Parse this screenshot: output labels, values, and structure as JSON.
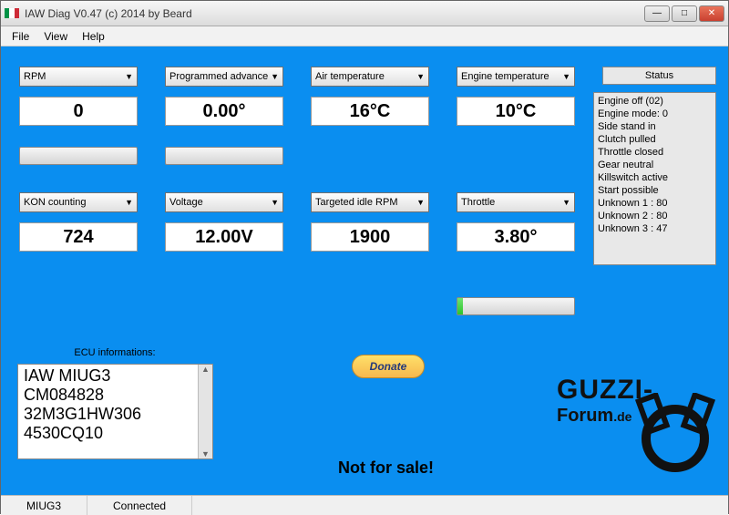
{
  "titlebar": {
    "text": "IAW Diag V0.47  (c) 2014 by Beard"
  },
  "menu": {
    "file": "File",
    "view": "View",
    "help": "Help"
  },
  "dd": {
    "rpm": "RPM",
    "adv": "Programmed advance",
    "air": "Air temperature",
    "eng": "Engine temperature",
    "kon": "KON counting",
    "volt": "Voltage",
    "idle": "Targeted idle RPM",
    "thr": "Throttle"
  },
  "val": {
    "rpm": "0",
    "adv": "0.00°",
    "air": "16°C",
    "eng": "10°C",
    "kon": "724",
    "volt": "12.00V",
    "idle": "1900",
    "thr": "3.80°"
  },
  "status": {
    "header": "Status",
    "l0": "Engine off (02)",
    "l1": "Engine mode: 0",
    "l2": "Side stand in",
    "l3": "Clutch pulled",
    "l4": "Throttle closed",
    "l5": "Gear neutral",
    "l6": "Killswitch active",
    "l7": "Start possible",
    "l8": "Unknown 1 : 80",
    "l9": "Unknown 2 : 80",
    "l10": "Unknown 3 : 47"
  },
  "ecu": {
    "header": "ECU informations:",
    "l0": "IAW MIUG3",
    "l1": "CM084828",
    "l2": "32M3G1HW306",
    "l3": "4530CQ10"
  },
  "donate": "Donate",
  "nfs": "Not for sale!",
  "logo": {
    "t1": "GUZZI-",
    "t2": "Forum",
    "t3": ".de"
  },
  "statusbar": {
    "c1": "MIUG3",
    "c2": "Connected"
  }
}
